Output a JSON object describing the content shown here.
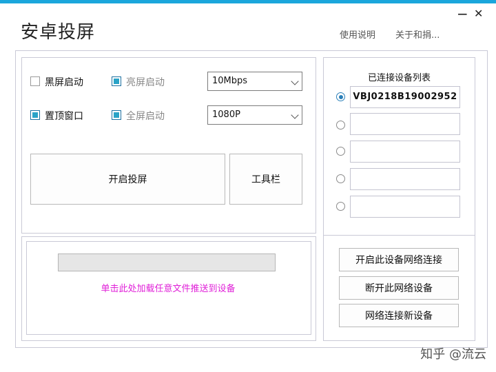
{
  "window": {
    "title": "安卓投屏",
    "minimize_glyph": "−",
    "close_glyph": "✕",
    "accent_color": "#1aa6dc"
  },
  "top_links": {
    "help": "使用说明",
    "about": "关于和捐..."
  },
  "options": {
    "black_screen": {
      "label": "黑屏启动",
      "checked": false
    },
    "bright_screen": {
      "label": "亮屏启动",
      "checked": true
    },
    "stay_on_top": {
      "label": "置顶窗口",
      "checked": true
    },
    "fullscreen": {
      "label": "全屏启动",
      "checked": true
    },
    "bitrate": {
      "value": "10Mbps"
    },
    "resolution": {
      "value": "1080P"
    }
  },
  "buttons": {
    "start_mirroring": "开启投屏",
    "toolbar": "工具栏",
    "enable_network": "开启此设备网络连接",
    "disconnect_network": "断开此网络设备",
    "connect_new": "网络连接新设备"
  },
  "devices": {
    "title": "已连接设备列表",
    "items": [
      {
        "id": "VBJ0218B19002952",
        "selected": true
      },
      {
        "id": "",
        "selected": false
      },
      {
        "id": "",
        "selected": false
      },
      {
        "id": "",
        "selected": false
      },
      {
        "id": "",
        "selected": false
      }
    ]
  },
  "file_push": {
    "progress": 0,
    "link_text": "单击此处加载任意文件推送到设备",
    "link_color": "#e020d8"
  },
  "watermark": "知乎 @流云"
}
